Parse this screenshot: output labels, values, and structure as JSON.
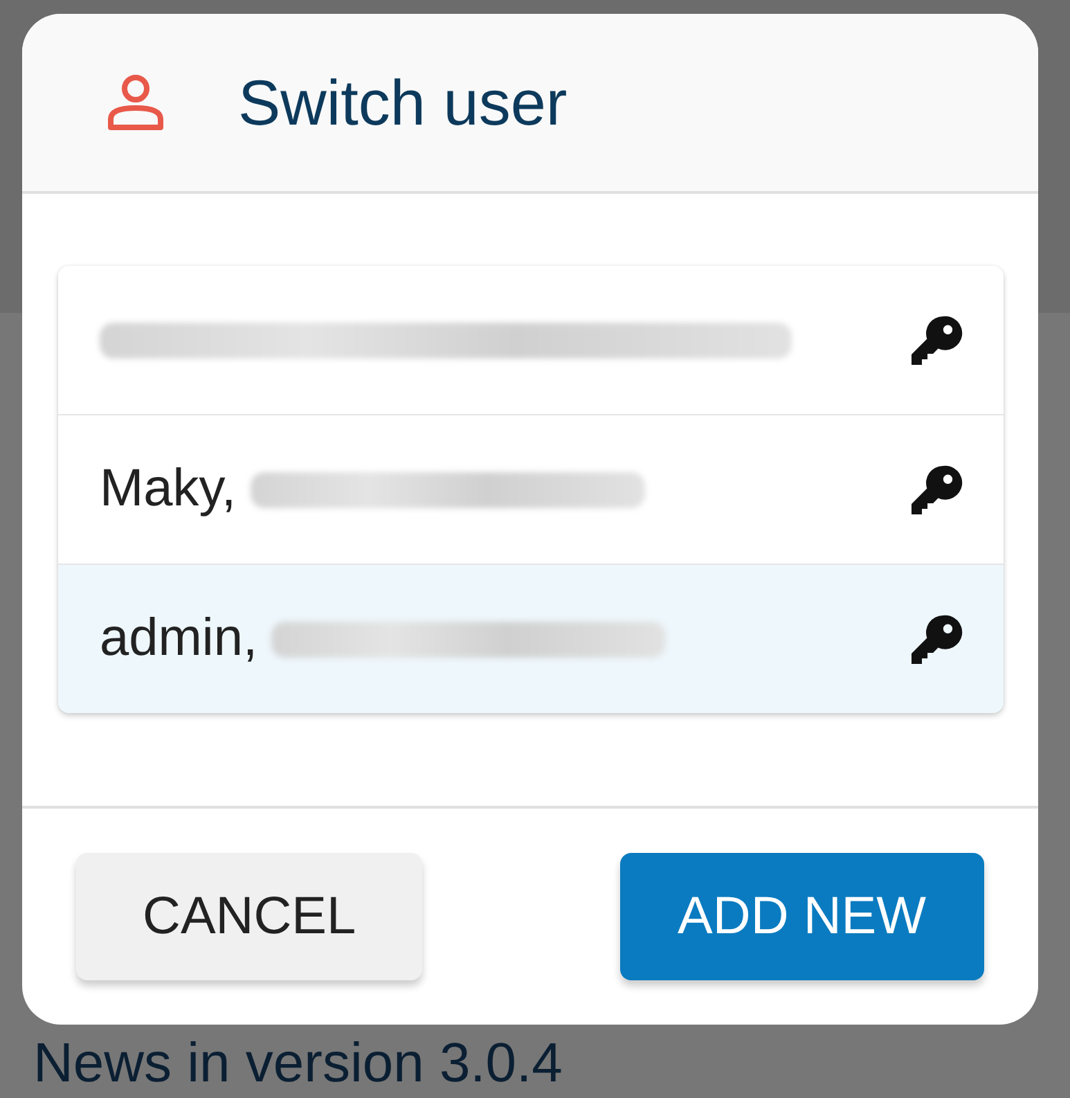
{
  "background": {
    "footer_text": "News in version 3.0.4"
  },
  "dialog": {
    "title": "Switch user",
    "users": [
      {
        "redacted": true,
        "selected": false
      },
      {
        "name": "Maky,",
        "redacted": true,
        "selected": false
      },
      {
        "name": "admin,",
        "redacted": true,
        "selected": true
      }
    ],
    "buttons": [
      {
        "label": "CANCEL",
        "kind": "secondary"
      },
      {
        "label": "ADD NEW",
        "kind": "primary"
      }
    ]
  }
}
